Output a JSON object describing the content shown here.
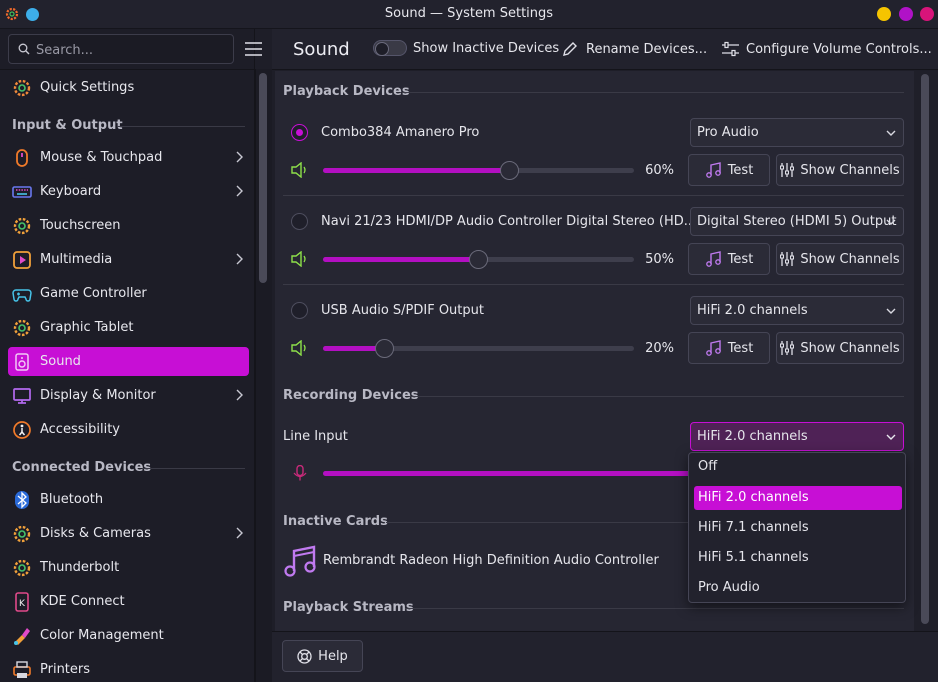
{
  "window": {
    "title": "Sound — System Settings"
  },
  "sidebar": {
    "search_placeholder": "Search...",
    "quick_settings": "Quick Settings",
    "sections": {
      "input_output": "Input & Output",
      "connected_devices": "Connected Devices"
    },
    "items": {
      "mouse": "Mouse & Touchpad",
      "keyboard": "Keyboard",
      "touchscreen": "Touchscreen",
      "multimedia": "Multimedia",
      "game_controller": "Game Controller",
      "graphic_tablet": "Graphic Tablet",
      "sound": "Sound",
      "display": "Display & Monitor",
      "accessibility": "Accessibility",
      "bluetooth": "Bluetooth",
      "disks": "Disks & Cameras",
      "thunderbolt": "Thunderbolt",
      "kde_connect": "KDE Connect",
      "color_management": "Color Management",
      "printers": "Printers"
    }
  },
  "header": {
    "title": "Sound",
    "show_inactive": "Show Inactive Devices",
    "rename": "Rename Devices...",
    "configure": "Configure Volume Controls..."
  },
  "playback": {
    "title": "Playback Devices",
    "devices": [
      {
        "name": "Combo384 Amanero Pro",
        "profile": "Pro Audio",
        "volume_label": "60%",
        "volume": 60,
        "selected": true
      },
      {
        "name": "Navi 21/23 HDMI/DP Audio Controller Digital Stereo (HD...",
        "profile": "Digital Stereo (HDMI 5) Output",
        "volume_label": "50%",
        "volume": 50,
        "selected": false
      },
      {
        "name": "USB Audio S/PDIF Output",
        "profile": "HiFi 2.0 channels",
        "volume_label": "20%",
        "volume": 20,
        "selected": false
      }
    ],
    "test_label": "Test",
    "channels_label": "Show Channels"
  },
  "recording": {
    "title": "Recording Devices",
    "device": {
      "name": "Line Input",
      "profile": "HiFi 2.0 channels",
      "volume": 100
    },
    "dropdown_options": [
      "Off",
      "HiFi 2.0 channels",
      "HiFi 7.1 channels",
      "HiFi 5.1 channels",
      "Pro Audio"
    ],
    "dropdown_selected_index": 1
  },
  "inactive_cards": {
    "title": "Inactive Cards",
    "card_name": "Rembrandt Radeon High Definition Audio Controller"
  },
  "playback_streams": {
    "title": "Playback Streams"
  },
  "footer": {
    "help": "Help"
  },
  "colors": {
    "accent": "#c70fd5",
    "slider_fill": "#b30fc2",
    "background": "#262632"
  }
}
